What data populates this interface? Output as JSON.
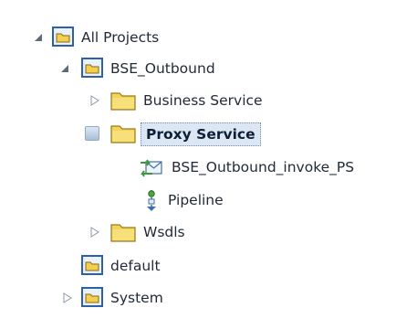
{
  "tree": {
    "all_projects": "All Projects",
    "bse_outbound": "BSE_Outbound",
    "business_service": "Business Service",
    "proxy_service": "Proxy Service",
    "bse_outbound_invoke_ps": "BSE_Outbound_invoke_PS",
    "pipeline": "Pipeline",
    "wsdls": "Wsdls",
    "default": "default",
    "system": "System"
  },
  "icons": {
    "expanded": "triangle-expanded-icon",
    "collapsed": "triangle-collapsed-icon",
    "folder": "folder-icon",
    "project": "project-folder-icon",
    "proxy": "proxy-service-icon",
    "pipeline": "pipeline-icon"
  },
  "colors": {
    "selection_bg": "#dde7f3",
    "selection_border": "#6f8fb8",
    "folder_yellow": "#f2cf4e",
    "project_blue": "#2e5fa8"
  }
}
